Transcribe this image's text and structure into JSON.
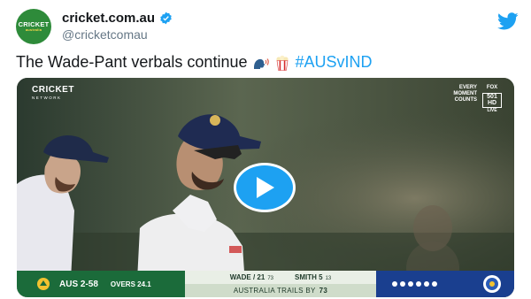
{
  "tweet": {
    "avatar_logo": "CRICKET",
    "avatar_sub": "australia",
    "display_name": "cricket.com.au",
    "handle": "@cricketcomau",
    "text": "The Wade-Pant verbals continue",
    "emojis": [
      "speaking-head-emoji",
      "popcorn-emoji"
    ],
    "hashtag": "#AUSvIND"
  },
  "video": {
    "watermark_left": "CRICKET",
    "watermark_left_sub": "NETWORK",
    "watermark_right_lines": [
      "EVERY",
      "MOMENT",
      "COUNTS"
    ],
    "channel_brand": "FOX",
    "channel_number": "501 HD",
    "channel_live": "LIVE",
    "scorebar": {
      "team_score": "AUS 2-58",
      "overs": "OVERS 24.1",
      "batsman1_name": "WADE",
      "batsman1_runs": "21",
      "batsman1_balls": "73",
      "batsman2_name": "SMITH",
      "batsman2_runs": "5",
      "batsman2_balls": "13",
      "trails_text": "AUSTRALIA TRAILS BY",
      "trails_by": "73"
    }
  },
  "colors": {
    "brand_twitter": "#1da1f2",
    "score_green": "#1b6b3a",
    "score_blue": "#1a3f8f"
  }
}
